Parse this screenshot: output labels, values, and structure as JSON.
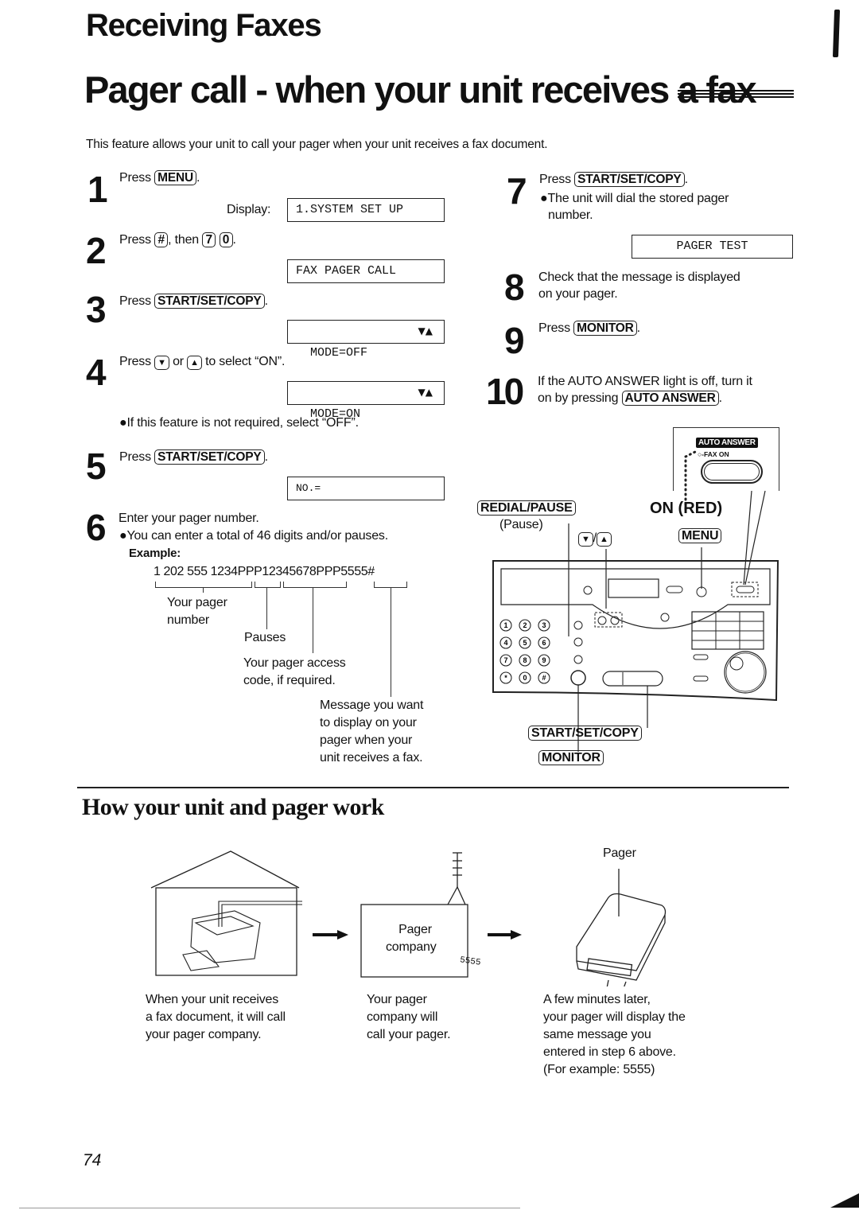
{
  "header": {
    "section": "Receiving Faxes",
    "title": "Pager call - when your unit receives a fax",
    "intro": "This feature allows your unit to call your pager when your unit receives a fax document."
  },
  "steps": [
    {
      "num": "1",
      "text_before": "Press",
      "key": "MENU",
      "text_after": ".",
      "display_label": "Display:",
      "display": "1.SYSTEM SET UP"
    },
    {
      "num": "2",
      "text_before": "Press",
      "key": "#",
      "text_mid": ", then",
      "keys": [
        "7",
        "0"
      ],
      "text_after": ".",
      "display": "FAX PAGER CALL"
    },
    {
      "num": "3",
      "text_before": "Press",
      "key": "START/SET/COPY",
      "text_after": ".",
      "display": "MODE=OFF",
      "display_arrows": "▼▲"
    },
    {
      "num": "4",
      "text_before": "Press",
      "key_down": "▼",
      "text_or": "or",
      "key_up": "▲",
      "text_after": "to select “ON”.",
      "display": "MODE=ON",
      "display_arrows": "▼▲",
      "note": "●If this feature is not required, select “OFF”."
    },
    {
      "num": "5",
      "text_before": "Press",
      "key": "START/SET/COPY",
      "text_after": ".",
      "display": "NO.="
    },
    {
      "num": "6",
      "text": "Enter your pager number.",
      "note": "●You can enter a total of 46 digits and/or pauses.",
      "example_label": "Example:",
      "example": "1 202 555 1234PPP12345678PPP5555#",
      "example_labels": {
        "pager_number": [
          "Your pager",
          "number"
        ],
        "pauses": "Pauses",
        "access_code": [
          "Your pager access",
          "code, if required."
        ],
        "message": [
          "Message you want",
          "to display on your",
          "pager when your",
          "unit receives a fax."
        ]
      }
    },
    {
      "num": "7",
      "text_before": "Press",
      "key": "START/SET/COPY",
      "text_after": ".",
      "note_lines": [
        "●The unit will dial the stored pager",
        "number."
      ],
      "display": "PAGER TEST"
    },
    {
      "num": "8",
      "lines": [
        "Check that the message is displayed",
        "on your pager."
      ]
    },
    {
      "num": "9",
      "text_before": "Press",
      "key": "MONITOR",
      "text_after": "."
    },
    {
      "num": "10",
      "line1": "If the AUTO ANSWER light is off, turn it",
      "text_before": "on by pressing",
      "key": "AUTO ANSWER",
      "text_after": "."
    }
  ],
  "panel": {
    "auto_answer_label": "AUTO ANSWER",
    "fax_on_label": "FAX ON",
    "on_red_label": "ON (RED)",
    "redial_key": "REDIAL/PAUSE",
    "pause_label": "(Pause)",
    "arrow_down": "▼",
    "arrow_up": "▲",
    "menu_key": "MENU",
    "start_key": "START/SET/COPY",
    "monitor_key": "MONITOR",
    "keypad": [
      "1",
      "2",
      "3",
      "4",
      "5",
      "6",
      "7",
      "8",
      "9",
      "*",
      "0",
      "#"
    ]
  },
  "how_it_works": {
    "title": "How your unit and pager work",
    "pager_company_box": [
      "Pager",
      "company"
    ],
    "pager_label": "Pager",
    "pager_display": "5555",
    "captions": [
      [
        "When your unit receives",
        "a fax document, it will call",
        "your pager company."
      ],
      [
        "Your pager",
        "company will",
        "call your pager."
      ],
      [
        "A few minutes later,",
        "your pager will display the",
        "same message you",
        "entered in step 6 above.",
        "(For example: 5555)"
      ]
    ]
  },
  "footer": {
    "page_number": "74"
  }
}
